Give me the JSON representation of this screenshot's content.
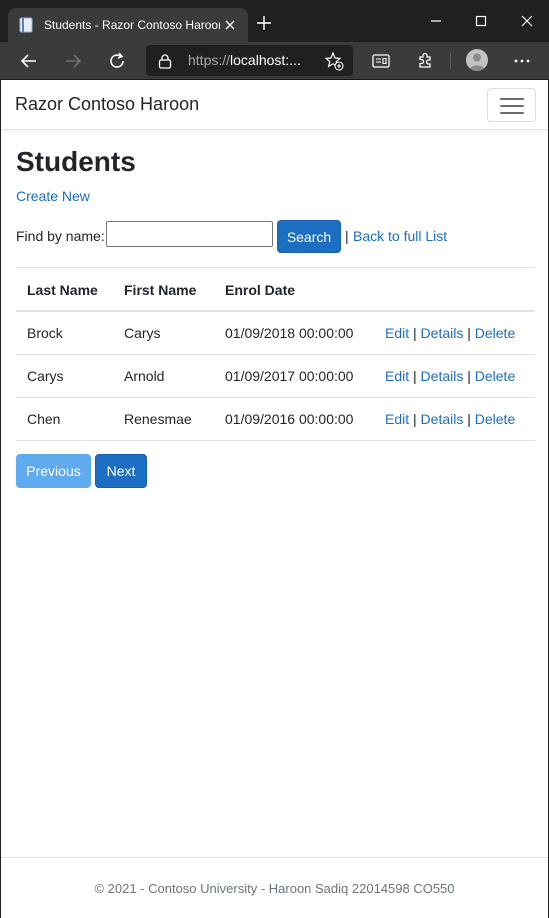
{
  "browser": {
    "tab_title": "Students - Razor Contoso Haroon",
    "url_prefix": "https://",
    "url_host": "localhost:..."
  },
  "navbar": {
    "brand": "Razor Contoso Haroon"
  },
  "page": {
    "heading": "Students",
    "create_new": "Create New",
    "find_label": "Find by name:",
    "search_value": "",
    "search_button": "Search",
    "separator": "|",
    "back_link": "Back to full List"
  },
  "table": {
    "headers": {
      "last_name": "Last Name",
      "first_name": "First Name",
      "enrol_date": "Enrol Date"
    },
    "rows": [
      {
        "last_name": "Brock",
        "first_name": "Carys",
        "enrol_date": "01/09/2018 00:00:00"
      },
      {
        "last_name": "Carys",
        "first_name": "Arnold",
        "enrol_date": "01/09/2017 00:00:00"
      },
      {
        "last_name": "Chen",
        "first_name": "Renesmae",
        "enrol_date": "01/09/2016 00:00:00"
      }
    ],
    "actions": {
      "edit": "Edit",
      "details": "Details",
      "delete": "Delete",
      "pipe": "|"
    }
  },
  "pagination": {
    "previous": "Previous",
    "next": "Next"
  },
  "footer": {
    "text": "© 2021 - Contoso University - Haroon Sadiq 22014598 CO550"
  },
  "colors": {
    "primary": "#1b6ec2",
    "primary_disabled": "#58a6f0",
    "chrome_dark": "#202020",
    "chrome_toolbar": "#3b3b3b"
  },
  "icons": [
    "page-favicon-icon",
    "close-icon",
    "plus-icon",
    "minimize-icon",
    "maximize-icon",
    "window-close-icon",
    "back-arrow-icon",
    "forward-arrow-icon",
    "refresh-icon",
    "lock-icon",
    "add-favorite-icon",
    "reader-view-icon",
    "extensions-icon",
    "profile-avatar-icon",
    "more-options-icon",
    "hamburger-menu-icon"
  ]
}
